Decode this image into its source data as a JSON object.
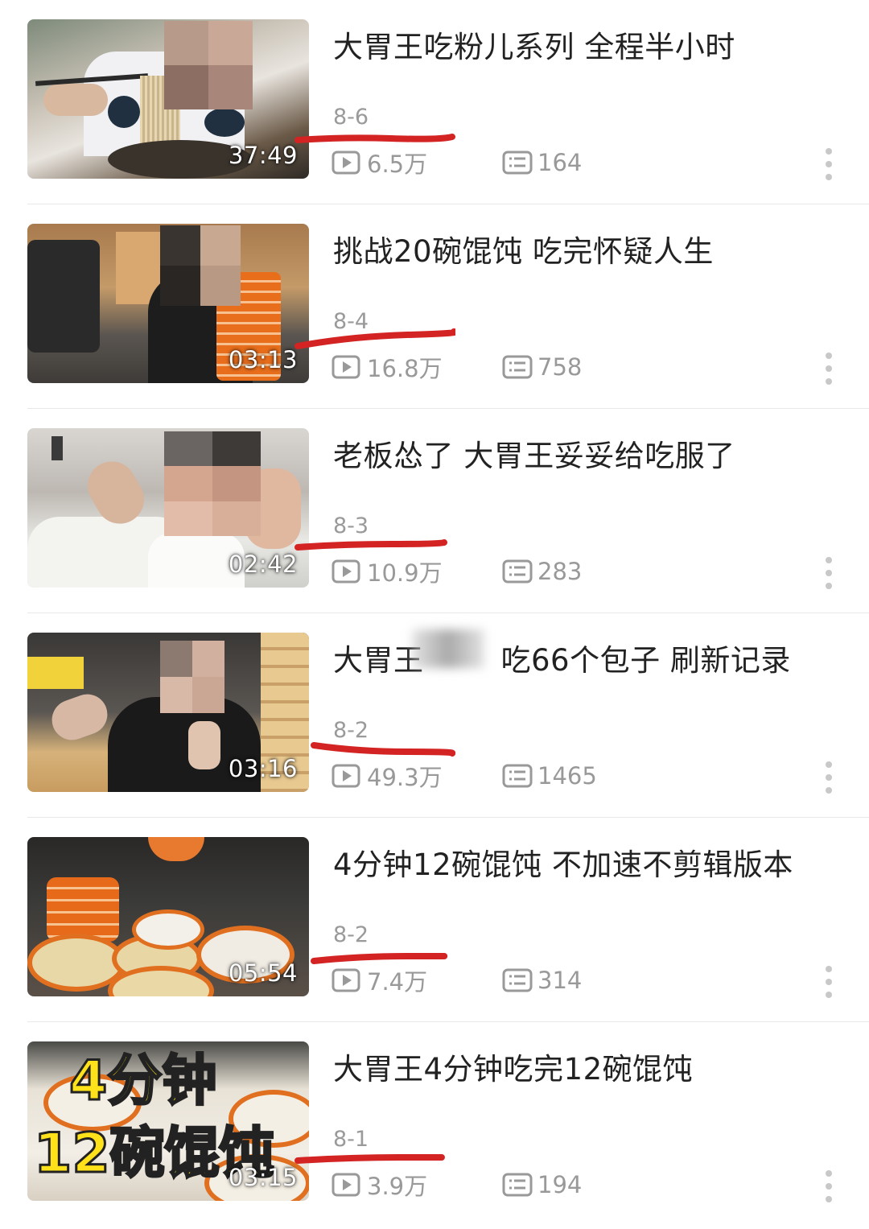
{
  "colors": {
    "annotation_red": "#d42323",
    "title_text": "#222222",
    "meta_text": "#999999"
  },
  "videos": [
    {
      "title": "大胃王吃粉儿系列 全程半小时",
      "date": "8-6",
      "duration": "37:49",
      "views": "6.5万",
      "comments": "164",
      "thumb_icon": "noodle-eating-thumbnail"
    },
    {
      "title": "挑战20碗馄饨 吃完怀疑人生",
      "date": "8-4",
      "duration": "03:13",
      "views": "16.8万",
      "comments": "758",
      "thumb_icon": "bowl-stack-thumbnail"
    },
    {
      "title": "老板怂了 大胃王妥妥给吃服了",
      "date": "8-3",
      "duration": "02:42",
      "views": "10.9万",
      "comments": "283",
      "thumb_icon": "peace-sign-thumbnail"
    },
    {
      "title": "大胃王",
      "title_rest": "吃66个包子 刷新记录",
      "date": "8-2",
      "duration": "03:16",
      "views": "49.3万",
      "comments": "1465",
      "thumb_icon": "steamer-baskets-thumbnail"
    },
    {
      "title": "4分钟12碗馄饨 不加速不剪辑版本",
      "date": "8-2",
      "duration": "05:54",
      "views": "7.4万",
      "comments": "314",
      "thumb_icon": "wonton-bowls-thumbnail"
    },
    {
      "title": "大胃王4分钟吃完12碗馄饨",
      "date": "8-1",
      "duration": "03:15",
      "views": "3.9万",
      "comments": "194",
      "thumb_icon": "wonton-overlay-thumbnail",
      "overlay_line1": "4分钟",
      "overlay_line2": "12碗馄饨"
    }
  ]
}
